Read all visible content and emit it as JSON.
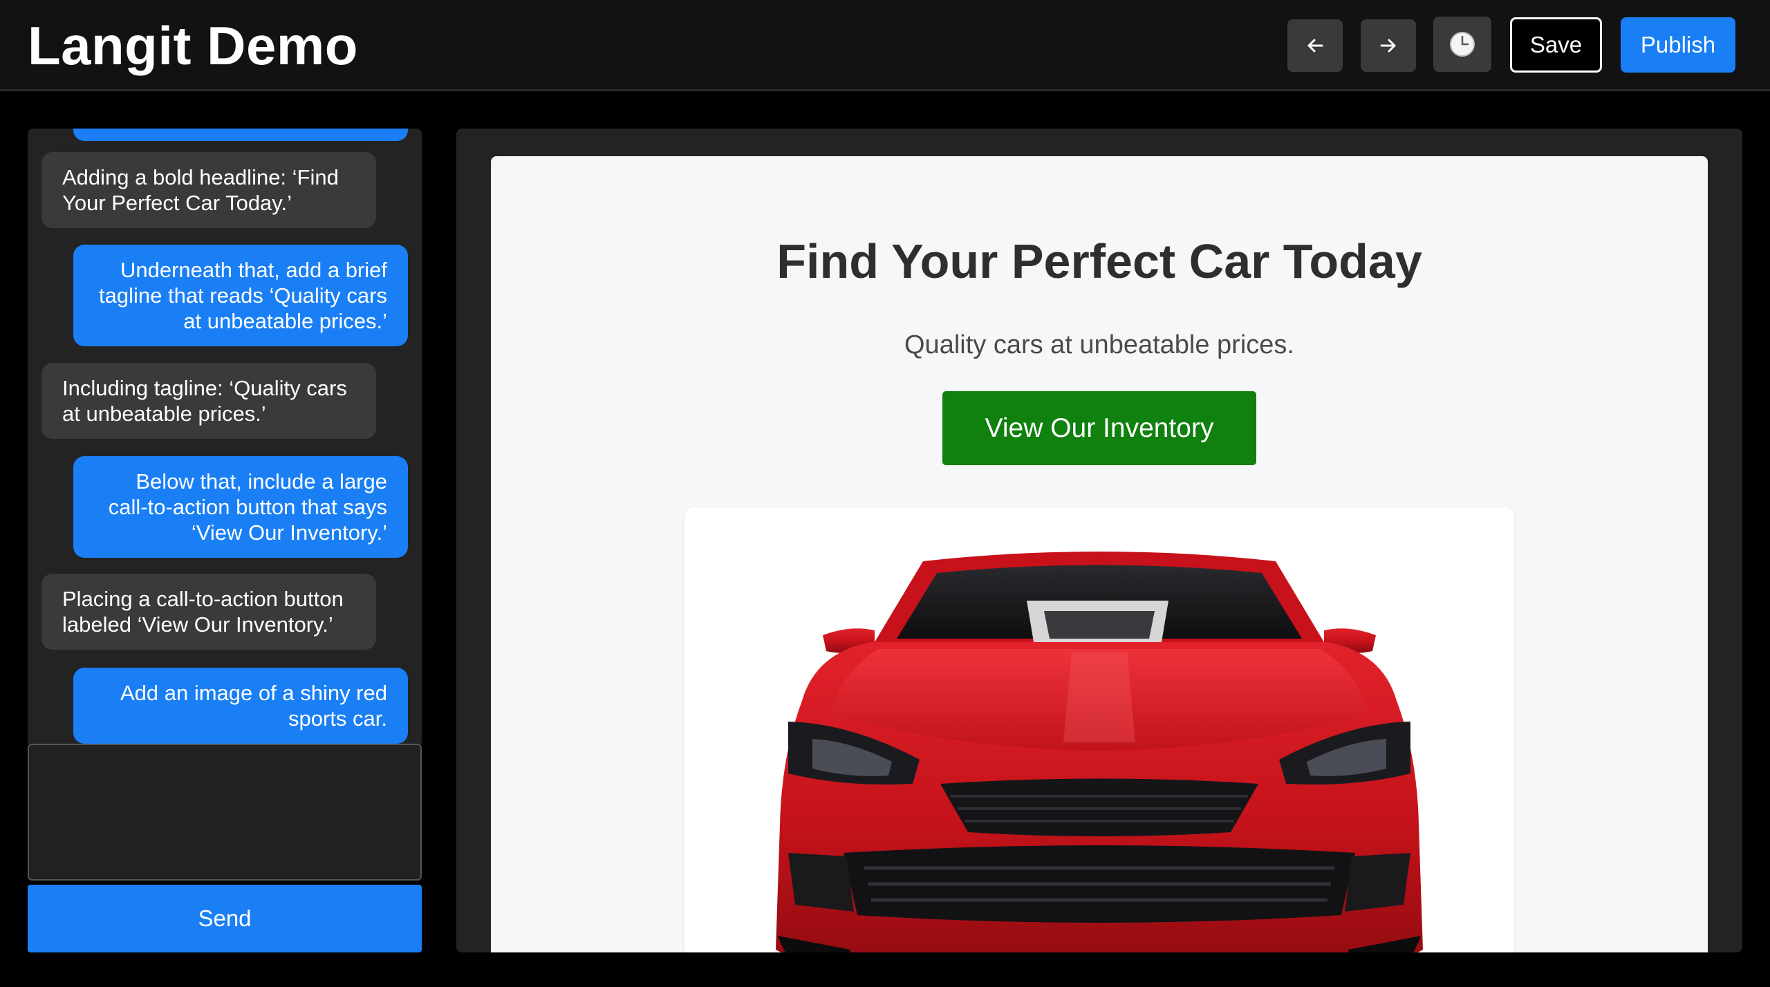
{
  "app": {
    "title": "Langit Demo"
  },
  "toolbar": {
    "back_icon": "arrow-left-icon",
    "forward_icon": "arrow-right-icon",
    "history_icon": "clock-icon",
    "save_label": "Save",
    "publish_label": "Publish"
  },
  "chat": {
    "messages": [
      {
        "role": "bot",
        "text": "Adding a bold headline: ‘Find Your Perfect Car Today.’"
      },
      {
        "role": "user",
        "text": "Underneath that, add a brief tagline that reads ‘Quality cars at unbeatable prices.’"
      },
      {
        "role": "bot",
        "text": "Including tagline: ‘Quality cars at unbeatable prices.’"
      },
      {
        "role": "user",
        "text": "Below that, include a large call-to-action button that says ‘View Our Inventory.’"
      },
      {
        "role": "bot",
        "text": "Placing a call-to-action button labeled ‘View Our Inventory.’"
      },
      {
        "role": "user",
        "text": "Add an image of a shiny red sports car."
      }
    ],
    "input_value": "",
    "send_label": "Send"
  },
  "preview": {
    "headline": "Find Your Perfect Car Today",
    "tagline": "Quality cars at unbeatable prices.",
    "cta_label": "View Our Inventory",
    "image_subject": "red-sports-car"
  },
  "colors": {
    "accent": "#1a7ff5",
    "cta": "#10800f",
    "car": "#d9161f"
  }
}
